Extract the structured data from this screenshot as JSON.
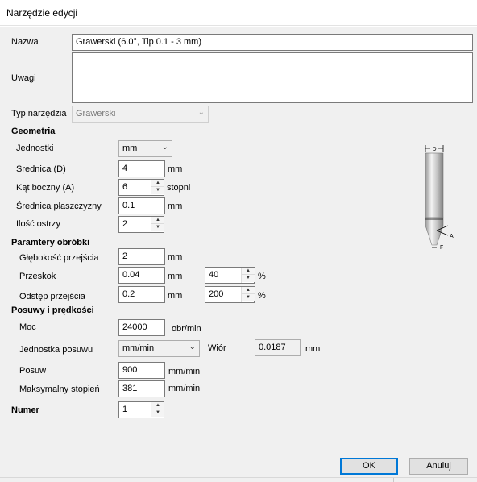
{
  "window": {
    "title": "Narzędzie edycji"
  },
  "fields": {
    "name_label": "Nazwa",
    "name_value": "Grawerski (6.0°, Tip 0.1 - 3 mm)",
    "notes_label": "Uwagi",
    "notes_value": "",
    "tooltype_label": "Typ narzędzia",
    "tooltype_value": "Grawerski"
  },
  "geometry": {
    "heading": "Geometria",
    "units_label": "Jednostki",
    "units_value": "mm",
    "diameter_label": "Średnica (D)",
    "diameter_value": "4",
    "diameter_unit": "mm",
    "angle_label": "Kąt boczny (A)",
    "angle_value": "6",
    "angle_unit": "stopni",
    "flat_label": "Średnica płaszczyzny",
    "flat_value": "0.1",
    "flat_unit": "mm",
    "flutes_label": "Ilość ostrzy",
    "flutes_value": "2",
    "diagram": {
      "label_d": "D",
      "label_a": "A",
      "label_f": "F"
    }
  },
  "machining": {
    "heading": "Paramtery obróbki",
    "depth_label": "Głębokość przejścia",
    "depth_value": "2",
    "depth_unit": "mm",
    "stepover_label": "Przeskok",
    "stepover_value": "0.04",
    "stepover_unit": "mm",
    "stepover_pct": "40",
    "stepover_pct_unit": "%",
    "stepdown_label": "Odstęp przejścia",
    "stepdown_value": "0.2",
    "stepdown_unit": "mm",
    "stepdown_pct": "200",
    "stepdown_pct_unit": "%"
  },
  "feeds": {
    "heading": "Posuwy i prędkości",
    "power_label": "Moc",
    "power_value": "24000",
    "power_unit": "obr/min",
    "feedunit_label": "Jednostka posuwu",
    "feedunit_value": "mm/min",
    "chip_label": "Wiór",
    "chip_value": "0.0187",
    "chip_unit": "mm",
    "feed_label": "Posuw",
    "feed_value": "900",
    "feed_unit": "mm/min",
    "maxstep_label": "Maksymalny stopień",
    "maxstep_value": "381",
    "maxstep_unit": "mm/min"
  },
  "number": {
    "heading": "Numer",
    "value": "1"
  },
  "buttons": {
    "ok": "OK",
    "cancel": "Anuluj"
  }
}
